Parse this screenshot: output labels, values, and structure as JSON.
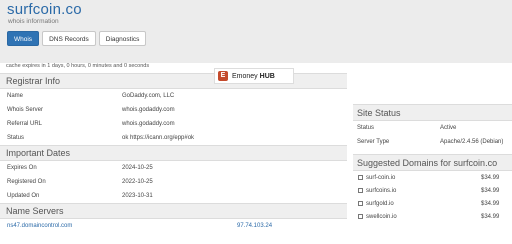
{
  "header": {
    "title": "surfcoin.co",
    "subtitle": "whois information",
    "tabs": [
      {
        "label": "Whois",
        "active": true
      },
      {
        "label": "DNS Records",
        "active": false
      },
      {
        "label": "Diagnostics",
        "active": false
      }
    ]
  },
  "cache_note": "cache expires in 1 days, 0 hours, 0 minutes and 0 seconds",
  "logo": {
    "mark": "E",
    "word1": "Emoney",
    "word2": "HUB"
  },
  "registrar": {
    "title": "Registrar Info",
    "rows": [
      {
        "key": "Name",
        "value": "GoDaddy.com, LLC"
      },
      {
        "key": "Whois Server",
        "value": "whois.godaddy.com"
      },
      {
        "key": "Referral URL",
        "value": "whois.godaddy.com"
      },
      {
        "key": "Status",
        "value": "ok https://icann.org/epp#ok"
      }
    ]
  },
  "dates": {
    "title": "Important Dates",
    "rows": [
      {
        "key": "Expires On",
        "value": "2024-10-25"
      },
      {
        "key": "Registered On",
        "value": "2022-10-25"
      },
      {
        "key": "Updated On",
        "value": "2023-10-31"
      }
    ]
  },
  "nameservers": {
    "title": "Name Servers",
    "rows": [
      {
        "host": "ns47.domaincontrol.com",
        "ip": "97.74.103.24"
      }
    ]
  },
  "site_status": {
    "title": "Site Status",
    "rows": [
      {
        "key": "Status",
        "value": "Active"
      },
      {
        "key": "Server Type",
        "value": "Apache/2.4.56 (Debian)"
      }
    ]
  },
  "suggested": {
    "title": "Suggested Domains for surfcoin.co",
    "items": [
      {
        "domain": "surf-coin.io",
        "price": "$34.99"
      },
      {
        "domain": "surfcoins.io",
        "price": "$34.99"
      },
      {
        "domain": "surfgold.io",
        "price": "$34.99"
      },
      {
        "domain": "swellcoin.io",
        "price": "$34.99"
      }
    ]
  },
  "colors": {
    "accent": "#2f73b4",
    "link": "#2b6aa8",
    "panel_bg": "#efefef"
  }
}
